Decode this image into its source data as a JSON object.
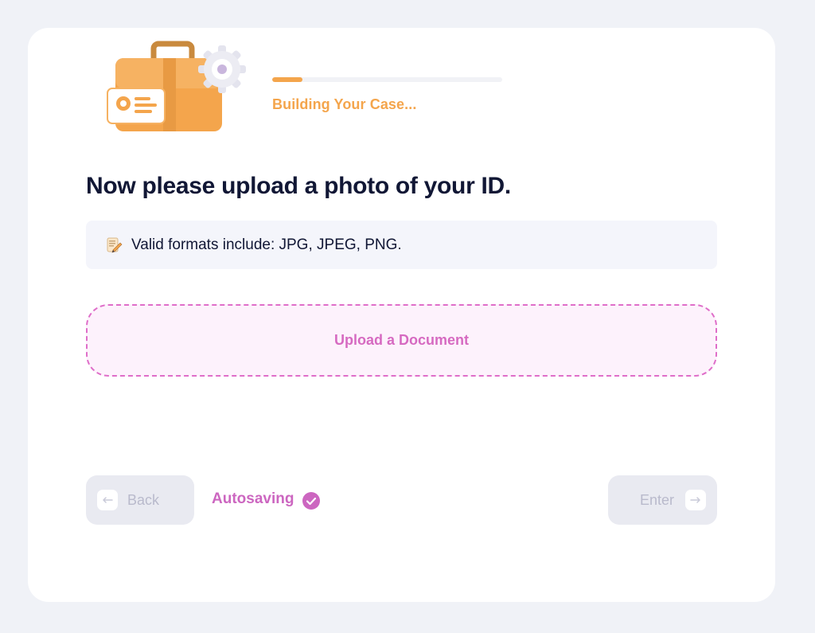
{
  "progress": {
    "label": "Building Your Case...",
    "fraction": 0.13,
    "color": "#f4a54c"
  },
  "illustration": {
    "icon": "briefcase-with-id-card-and-gear"
  },
  "question": {
    "title": "Now please upload a photo of your ID."
  },
  "hint": {
    "icon": "memo-pencil-icon",
    "text": "Valid formats include: JPG, JPEG, PNG."
  },
  "upload": {
    "label": "Upload a Document",
    "border_color": "#df6ec9"
  },
  "footer": {
    "back_label": "Back",
    "enter_label": "Enter",
    "autosave_label": "Autosaving",
    "autosave_icon": "check-circle-icon",
    "accent_color": "#cc66c0"
  }
}
